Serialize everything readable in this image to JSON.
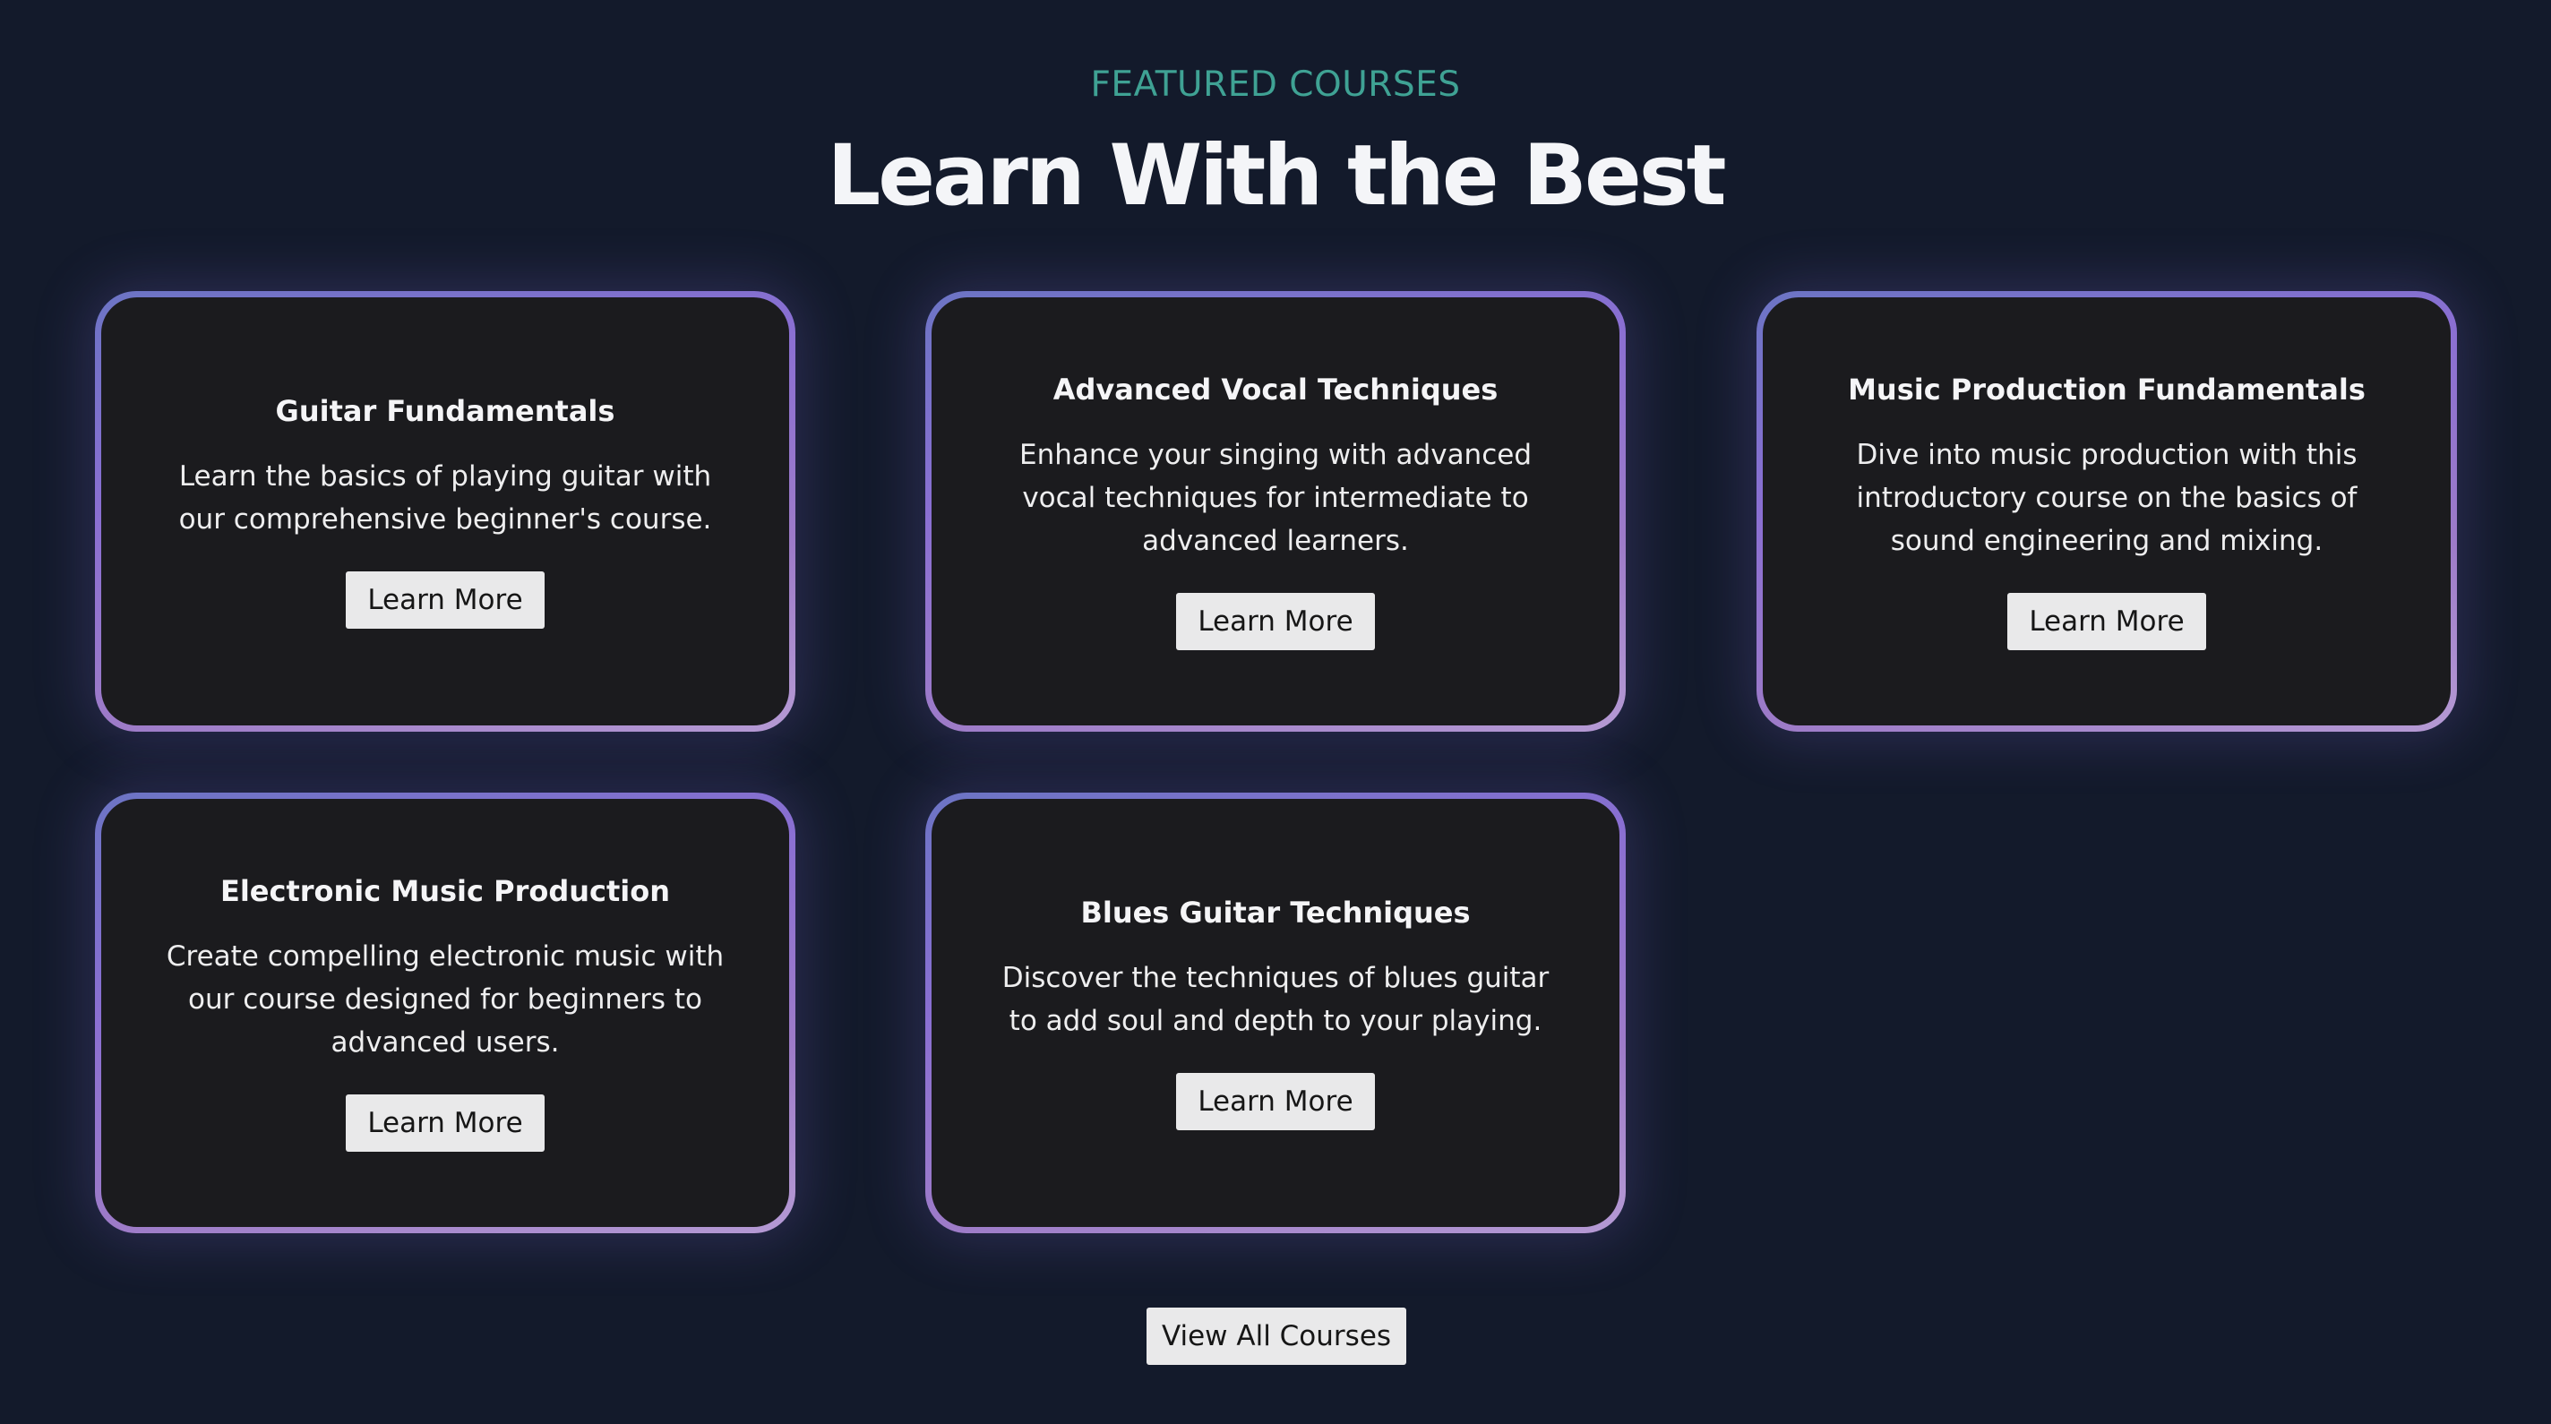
{
  "section": {
    "eyebrow": "FEATURED COURSES",
    "headline": "Learn With the Best",
    "view_all_label": "View All Courses"
  },
  "courses": [
    {
      "title": "Guitar Fundamentals",
      "description": "Learn the basics of playing guitar with our comprehensive beginner's course.",
      "button_label": "Learn More"
    },
    {
      "title": "Advanced Vocal Techniques",
      "description": "Enhance your singing with advanced vocal techniques for intermediate to advanced learners.",
      "button_label": "Learn More"
    },
    {
      "title": "Music Production Fundamentals",
      "description": "Dive into music production with this introductory course on the basics of sound engineering and mixing.",
      "button_label": "Learn More"
    },
    {
      "title": "Electronic Music Production",
      "description": "Create compelling electronic music with our course designed for beginners to advanced users.",
      "button_label": "Learn More"
    },
    {
      "title": "Blues Guitar Techniques",
      "description": "Discover the techniques of blues guitar to add soul and depth to your playing.",
      "button_label": "Learn More"
    }
  ],
  "colors": {
    "background": "#131a2b",
    "eyebrow": "#3fa294",
    "card_surface": "#1b1b1e",
    "card_border_start": "#6c74c4",
    "card_border_end": "#b59ad4",
    "button": "#e9e9ea"
  }
}
